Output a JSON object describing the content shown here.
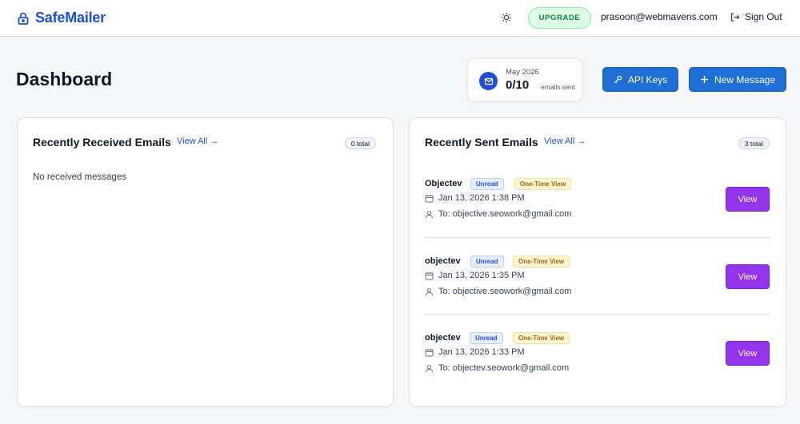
{
  "header": {
    "brand": "SafeMailer",
    "upgrade_label": "UPGRADE",
    "user_email": "prasoon@webmavens.com",
    "signout_label": "Sign Out",
    "icons": {
      "brand": "lock-icon",
      "theme": "sun-icon",
      "signout": "sign-out-icon"
    }
  },
  "page": {
    "title": "Dashboard"
  },
  "usage": {
    "month": "May 2026",
    "count": "0/10",
    "suffix": "emails sent",
    "icon": "mail-icon"
  },
  "actions": {
    "api_keys_label": "API Keys",
    "new_message_label": "New Message",
    "icons": {
      "api_keys": "key-icon",
      "new_message": "plus-icon"
    }
  },
  "received": {
    "title": "Recently Received Emails",
    "view_all": "View All →",
    "count_label": "0 total",
    "empty_message": "No received messages"
  },
  "sent": {
    "title": "Recently Sent Emails",
    "view_all": "View All →",
    "count_label": "3 total",
    "emails": [
      {
        "subject": "Objectev",
        "status": "Unread",
        "type": "One-Time View",
        "date": "Jan 13, 2026 1:38 PM",
        "to": "To: objective.seowork@gmail.com",
        "action": "View"
      },
      {
        "subject": "objectev",
        "status": "Unread",
        "type": "One-Time View",
        "date": "Jan 13, 2026 1:35 PM",
        "to": "To: objective.seowork@gmail.com",
        "action": "View"
      },
      {
        "subject": "objectev",
        "status": "Unread",
        "type": "One-Time View",
        "date": "Jan 13, 2026 1:33 PM",
        "to": "To: objectev.seowork@gmail.com",
        "action": "View"
      }
    ]
  },
  "colors": {
    "brand": "#1d4ed8",
    "primary_button": "#1d6fd6",
    "view_button": "#9333ea",
    "upgrade_bg": "#dcfce7",
    "upgrade_text": "#15803d"
  }
}
